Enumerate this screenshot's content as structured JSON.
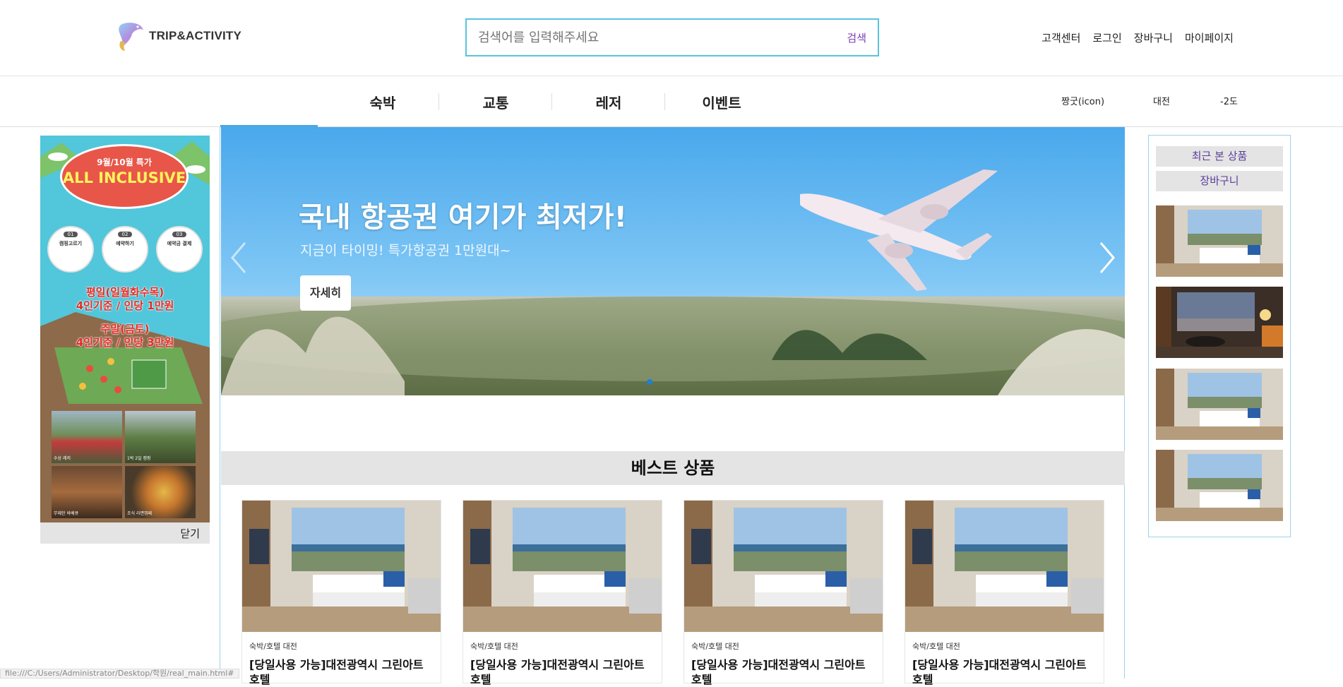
{
  "header": {
    "logo_text": "TRIP&ACTIVITY",
    "search_placeholder": "검색어를 입력해주세요",
    "search_button": "검색",
    "links": [
      "고객센터",
      "로그인",
      "장바구니",
      "마이페이지"
    ]
  },
  "categories": [
    "숙박",
    "교통",
    "레저",
    "이벤트"
  ],
  "weather": {
    "icon_label": "짱굿(icon)",
    "city": "대전",
    "temperature": "-2도"
  },
  "left_ad": {
    "title": "9월/10월 특가",
    "headline": "ALL INCLUSIVE",
    "steps": [
      {
        "num": "01",
        "title": "캠핑고르기"
      },
      {
        "num": "02",
        "title": "예약하기"
      },
      {
        "num": "03",
        "title": "예약금 결제"
      }
    ],
    "weekday_line1": "평일(일월화수목)",
    "weekday_line2": "4인기준 / 인당 1만원",
    "weekend_line1": "주말(금토)",
    "weekend_line2": "4인기준 / 인당 3만원",
    "photo_captions": [
      "수상 레저",
      "1박 2일 캠핑",
      "무제한 바베큐",
      "조식 라면뷔페"
    ],
    "close_label": "닫기"
  },
  "banner": {
    "title": "국내 항공권 여기가 최저가!",
    "subtitle": "지금이 타이밍! 특가항공권 1만원대~",
    "button": "자세히"
  },
  "best": {
    "heading": "베스트 상품",
    "products": [
      {
        "category": "숙박/호텔 대전",
        "name": "[당일사용 가능]대전광역시 그린아트 호텔"
      },
      {
        "category": "숙박/호텔 대전",
        "name": "[당일사용 가능]대전광역시 그린아트 호텔"
      },
      {
        "category": "숙박/호텔 대전",
        "name": "[당일사용 가능]대전광역시 그린아트 호텔"
      },
      {
        "category": "숙박/호텔 대전",
        "name": "[당일사용 가능]대전광역시 그린아트 호텔"
      }
    ]
  },
  "recent": {
    "tab_recent": "최근 본 상품",
    "tab_cart": "장바구니"
  },
  "status_url": "file:///C:/Users/Administrator/Desktop/학원/real_main.html#",
  "colors": {
    "accent_border": "#5bc2dd",
    "frame_border": "#9fd0ec",
    "tab_text": "#5b3d9a"
  }
}
